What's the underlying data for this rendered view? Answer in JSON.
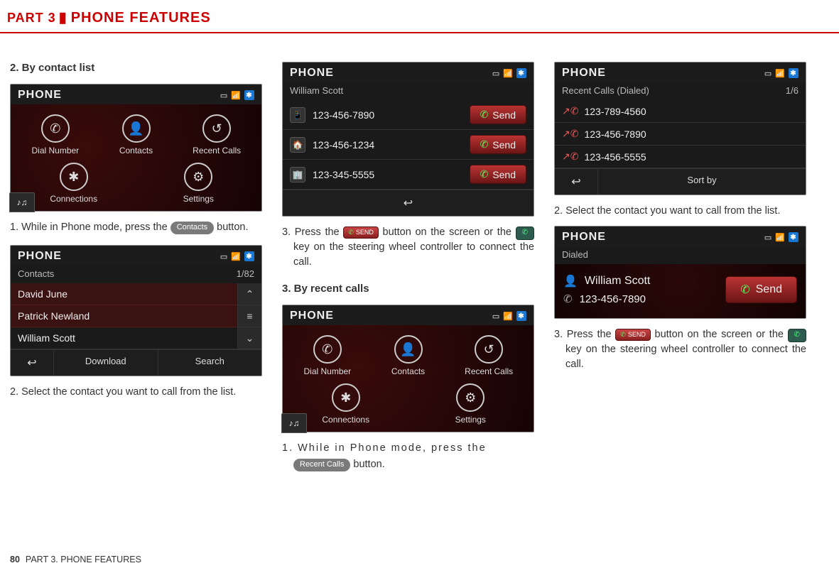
{
  "header": {
    "part": "PART 3",
    "title": "PHONE FEATURES"
  },
  "footer": {
    "page_num": "80",
    "label": "PART 3. PHONE FEATURES"
  },
  "col1": {
    "heading": "2. By contact list",
    "shot1": {
      "title": "PHONE",
      "buttons": [
        "Dial Number",
        "Contacts",
        "Recent Calls",
        "Connections",
        "Settings"
      ]
    },
    "step1_a": "1. While in Phone mode, press the ",
    "step1_btn": "Contacts",
    "step1_b": " button.",
    "shot2": {
      "title": "PHONE",
      "sub": "Contacts",
      "counter": "1/82",
      "items": [
        "David June",
        "Patrick Newland",
        "William Scott"
      ],
      "foot": [
        "Download",
        "Search"
      ]
    },
    "step2": "2. Select the contact you want to call from the list."
  },
  "col2": {
    "shot1": {
      "title": "PHONE",
      "sub": "William Scott",
      "rows": [
        {
          "icon": "📱",
          "num": "123-456-7890"
        },
        {
          "icon": "🏠",
          "num": "123-456-1234"
        },
        {
          "icon": "🏢",
          "num": "123-345-5555"
        }
      ],
      "send": "Send"
    },
    "step3_a": "3. Press the ",
    "step3_b": " button on the screen or the ",
    "step3_c": " key on the steering wheel controller to connect the call.",
    "heading": "3. By recent calls",
    "shot2": {
      "title": "PHONE",
      "buttons": [
        "Dial Number",
        "Contacts",
        "Recent Calls",
        "Connections",
        "Settings"
      ]
    },
    "step1_a": "1. While in Phone mode, press the ",
    "step1_btn": "Recent Calls",
    "step1_b": " button."
  },
  "col3": {
    "shot1": {
      "title": "PHONE",
      "sub": "Recent Calls (Dialed)",
      "counter": "1/6",
      "rows": [
        "123-789-4560",
        "123-456-7890",
        "123-456-5555"
      ],
      "sort": "Sort by"
    },
    "step2": "2. Select the contact you want to call from the list.",
    "shot2": {
      "title": "PHONE",
      "sub": "Dialed",
      "name": "William Scott",
      "num": "123-456-7890",
      "send": "Send"
    },
    "step3_a": "3. Press the ",
    "step3_b": " button on the screen or the ",
    "step3_c": " key on the steering wheel controller to connect the call."
  },
  "icons": {
    "send_label": "SEND"
  }
}
